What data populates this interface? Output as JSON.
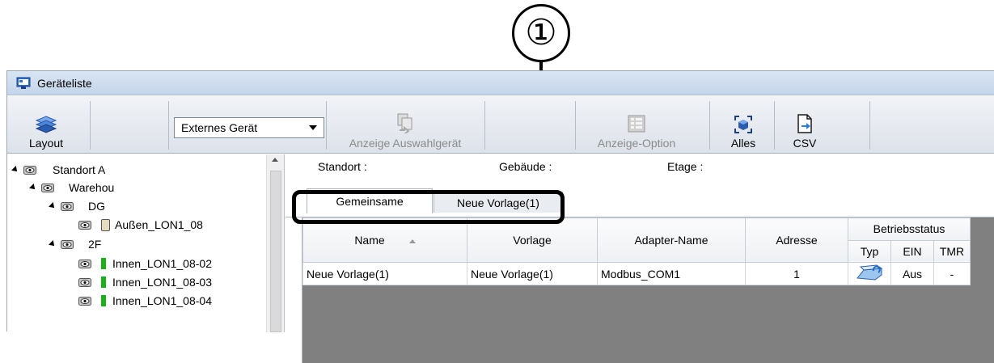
{
  "callout": {
    "number": "①"
  },
  "window": {
    "title": "Geräteliste"
  },
  "toolbar": {
    "layout_label": "Layout",
    "device_select_value": "Externes Gerät",
    "show_selected_label": "Anzeige Auswahlgerät",
    "display_option_label": "Anzeige-Option",
    "all_label": "Alles",
    "csv_label": "CSV"
  },
  "tree": {
    "items": [
      {
        "label": "Standort A"
      },
      {
        "label": "Warehou"
      },
      {
        "label": "DG"
      },
      {
        "label": "Außen_LON1_08"
      },
      {
        "label": "2F"
      },
      {
        "label": "Innen_LON1_08-02"
      },
      {
        "label": "Innen_LON1_08-03"
      },
      {
        "label": "Innen_LON1_08-04"
      }
    ]
  },
  "info": {
    "standort_label": "Standort :",
    "gebaeude_label": "Gebäude :",
    "etage_label": "Etage :"
  },
  "tabs": [
    {
      "label": "Gemeinsame"
    },
    {
      "label": "Neue Vorlage(1)"
    }
  ],
  "table": {
    "headers": {
      "name": "Name",
      "vorlage": "Vorlage",
      "adapter": "Adapter-Name",
      "adresse": "Adresse",
      "betriebsstatus": "Betriebsstatus",
      "typ": "Typ",
      "ein": "EIN",
      "tmr": "TMR"
    },
    "rows": [
      {
        "name": "Neue Vorlage(1)",
        "vorlage": "Neue Vorlage(1)",
        "adapter": "Modbus_COM1",
        "adresse": "1",
        "ein": "Aus",
        "tmr": "-"
      }
    ]
  },
  "colors": {
    "accent_green": "#19b019",
    "titlebar": "#c4d5ea"
  }
}
